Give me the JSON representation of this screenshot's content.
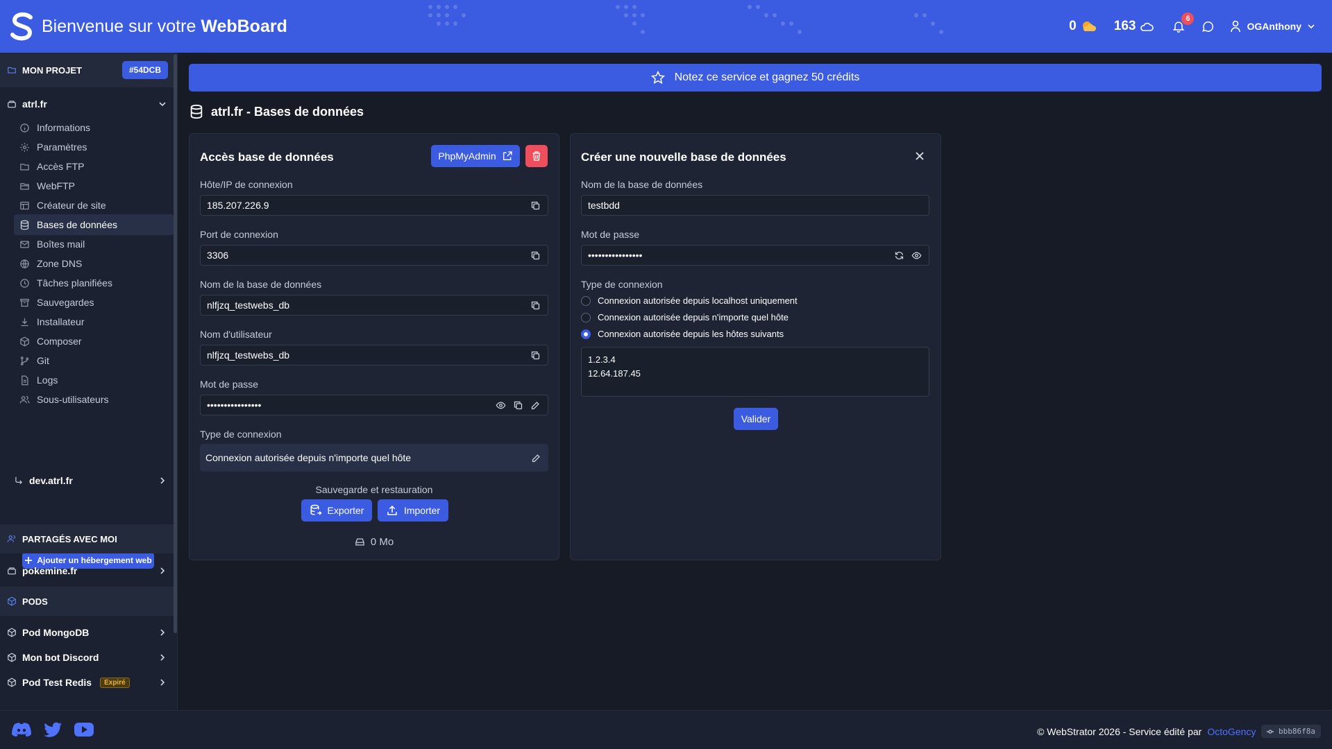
{
  "header": {
    "title_prefix": "Bienvenue sur votre",
    "title_brand": "WebBoard",
    "credits": "0",
    "cloud_count": "163",
    "notifications": "6",
    "username": "OGAnthony"
  },
  "sidebar": {
    "project_label": "MON PROJET",
    "project_tag": "#54DCB",
    "site": "atrl.fr",
    "items": [
      {
        "label": "Informations",
        "icon": "info-icon"
      },
      {
        "label": "Paramètres",
        "icon": "gear-icon"
      },
      {
        "label": "Accès FTP",
        "icon": "folder-icon"
      },
      {
        "label": "WebFTP",
        "icon": "folder-open-icon"
      },
      {
        "label": "Créateur de site",
        "icon": "layout-icon"
      },
      {
        "label": "Bases de données",
        "icon": "database-icon"
      },
      {
        "label": "Boîtes mail",
        "icon": "mail-icon"
      },
      {
        "label": "Zone DNS",
        "icon": "globe-icon"
      },
      {
        "label": "Tâches planifiées",
        "icon": "clock-icon"
      },
      {
        "label": "Sauvegardes",
        "icon": "archive-icon"
      },
      {
        "label": "Installateur",
        "icon": "download-icon"
      },
      {
        "label": "Composer",
        "icon": "package-icon"
      },
      {
        "label": "Git",
        "icon": "git-icon"
      },
      {
        "label": "Logs",
        "icon": "file-icon"
      },
      {
        "label": "Sous-utilisateurs",
        "icon": "users-icon"
      }
    ],
    "subsite": "dev.atrl.fr",
    "add_button": "Ajouter un hébergement web",
    "shared_label": "PARTAGÉS AVEC MOI",
    "shared_site": "pokemine.fr",
    "pods_label": "PODS",
    "pods": [
      {
        "label": "Pod MongoDB"
      },
      {
        "label": "Mon bot Discord"
      },
      {
        "label": "Pod Test Redis",
        "badge": "Expiré"
      }
    ]
  },
  "banner": {
    "text": "Notez ce service et gagnez 50 crédits"
  },
  "page_title": "atrl.fr - Bases de données",
  "access_card": {
    "title": "Accès base de données",
    "phpmyadmin_label": "PhpMyAdmin",
    "host_label": "Hôte/IP de connexion",
    "host_value": "185.207.226.9",
    "port_label": "Port de connexion",
    "port_value": "3306",
    "dbname_label": "Nom de la base de données",
    "dbname_value": "nlfjzq_testwebs_db",
    "user_label": "Nom d'utilisateur",
    "user_value": "nlfjzq_testwebs_db",
    "password_label": "Mot de passe",
    "password_value": "••••••••••••••••",
    "conn_type_label": "Type de connexion",
    "conn_type_value": "Connexion autorisée depuis n'importe quel hôte",
    "backup_label": "Sauvegarde et restauration",
    "export_label": "Exporter",
    "import_label": "Importer",
    "size": "0 Mo"
  },
  "create_card": {
    "title": "Créer une nouvelle base de données",
    "dbname_label": "Nom de la base de données",
    "dbname_value": "testbdd",
    "password_label": "Mot de passe",
    "password_value": "••••••••••••••••",
    "conn_type_label": "Type de connexion",
    "options": [
      "Connexion autorisée depuis localhost uniquement",
      "Connexion autorisée depuis n'importe quel hôte",
      "Connexion autorisée depuis les hôtes suivants"
    ],
    "selected_option": 2,
    "hosts": "1.2.3.4\n12.64.187.45",
    "submit_label": "Valider"
  },
  "footer": {
    "copyright": "© WebStrator 2026 - Service édité par",
    "company": "OctoGency",
    "version": "bbb86f8a"
  },
  "colors": {
    "primary": "#3b5be0",
    "danger": "#ef4f5c",
    "bg": "#161b26",
    "link": "#4f72ff"
  }
}
